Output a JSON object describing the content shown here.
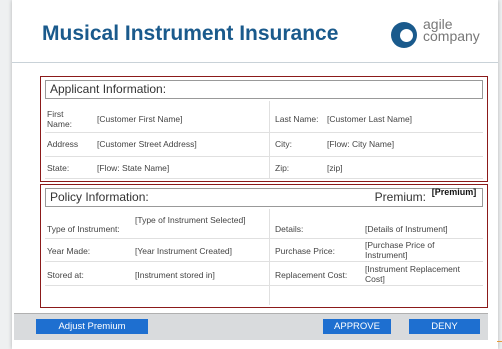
{
  "header": {
    "title": "Musical Instrument Insurance",
    "logo_line1": "agile",
    "logo_line2": "company"
  },
  "applicant": {
    "heading": "Applicant Information:",
    "first_name_label": "First Name:",
    "first_name_value": "[Customer First Name]",
    "last_name_label": "Last Name:",
    "last_name_value": "[Customer Last Name]",
    "address_label": "Address",
    "address_value": "[Customer Street Address]",
    "city_label": "City:",
    "city_value": "[Flow: City Name]",
    "state_label": "State:",
    "state_value": "[Flow: State Name]",
    "zip_label": "Zip:",
    "zip_value": "[zip]"
  },
  "policy": {
    "heading": "Policy Information:",
    "premium_label": "Premium:",
    "premium_value": "[Premium]",
    "type_label": "Type of Instrument:",
    "type_value": "[Type of Instrument Selected]",
    "details_label": "Details:",
    "details_value": "[Details of Instrument]",
    "year_label": "Year Made:",
    "year_value": "[Year Instrument Created]",
    "purchase_label": "Purchase Price:",
    "purchase_value": "[Purchase Price of Instrument]",
    "stored_label": "Stored at:",
    "stored_value": "[Instrument stored in]",
    "replacement_label": "Replacement Cost:",
    "replacement_value": "[Instrument Replacement Cost]"
  },
  "footer": {
    "adjust_label": "Adjust Premium",
    "approve_label": "APPROVE",
    "deny_label": "DENY"
  }
}
